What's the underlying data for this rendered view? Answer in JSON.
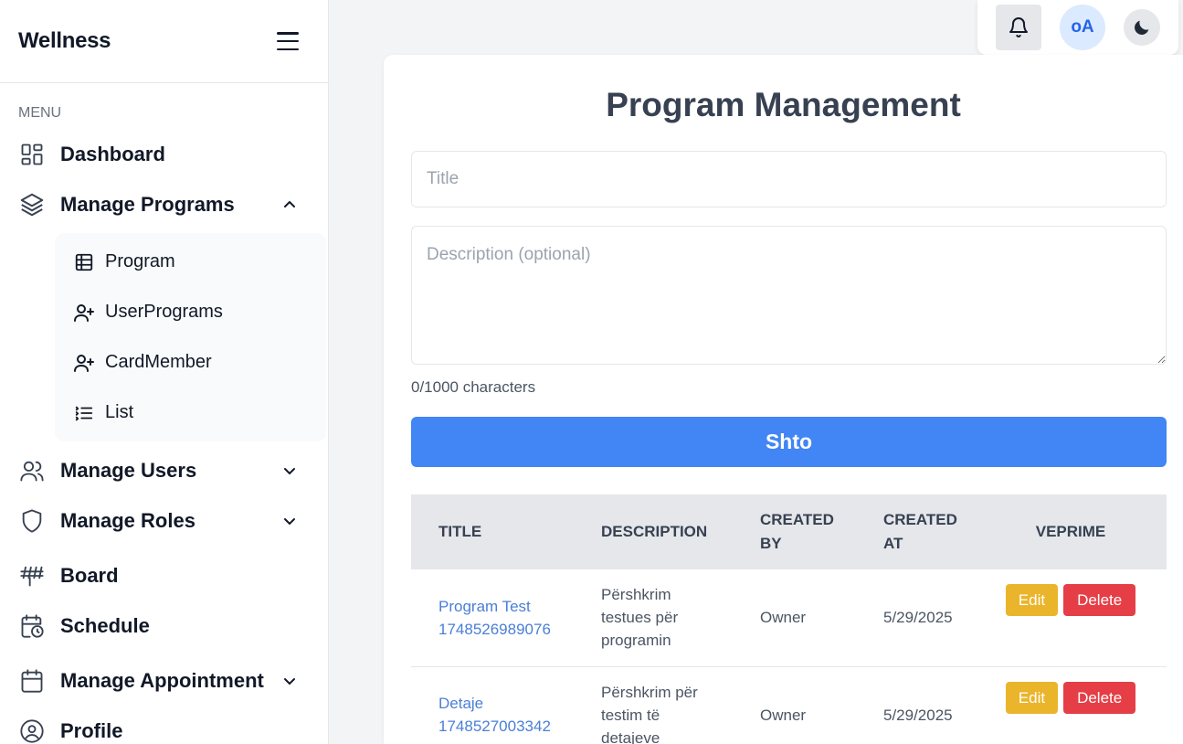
{
  "sidebar": {
    "brand": "Wellness",
    "menu_label": "MENU",
    "items": [
      {
        "label": "Dashboard",
        "icon": "grid-icon"
      },
      {
        "label": "Manage Programs",
        "icon": "layers-icon",
        "expanded": true,
        "children": [
          {
            "label": "Program",
            "icon": "table-icon"
          },
          {
            "label": "UserPrograms",
            "icon": "user-plus-icon"
          },
          {
            "label": "CardMember",
            "icon": "user-plus-icon"
          },
          {
            "label": "List",
            "icon": "list-icon"
          }
        ]
      },
      {
        "label": "Manage Users",
        "icon": "users-icon"
      },
      {
        "label": "Manage Roles",
        "icon": "shield-icon"
      },
      {
        "label": "Board",
        "icon": "board-icon"
      },
      {
        "label": "Schedule",
        "icon": "calendar-clock-icon"
      },
      {
        "label": "Manage Appointment",
        "icon": "calendar-icon"
      },
      {
        "label": "Profile",
        "icon": "user-circle-icon"
      }
    ]
  },
  "topbar": {
    "avatar_initials": "oA",
    "icons": [
      "bell-icon",
      "moon-icon"
    ]
  },
  "main": {
    "title": "Program Management",
    "title_placeholder": "Title",
    "description_placeholder": "Description (optional)",
    "char_count": "0/1000 characters",
    "submit_label": "Shto",
    "submit_color": "#4285f4",
    "table": {
      "headers": {
        "title": "TITLE",
        "description": "DESCRIPTION",
        "created_by_1": "CREATED",
        "created_by_2": "BY",
        "created_at_1": "CREATED",
        "created_at_2": "AT",
        "actions": "VEPRIME"
      },
      "rows": [
        {
          "title_1": "Program Test",
          "title_2": "1748526989076",
          "desc_1": "Përshkrim",
          "desc_2": "testues për",
          "desc_3": "programin",
          "created_by": "Owner",
          "created_at": "5/29/2025",
          "edit": "Edit",
          "delete": "Delete"
        },
        {
          "title_1": "Detaje",
          "title_2": "1748527003342",
          "desc_1": "Përshkrim për",
          "desc_2": "testim të",
          "desc_3": "detajeve",
          "created_by": "Owner",
          "created_at": "5/29/2025",
          "edit": "Edit",
          "delete": "Delete"
        }
      ]
    }
  }
}
